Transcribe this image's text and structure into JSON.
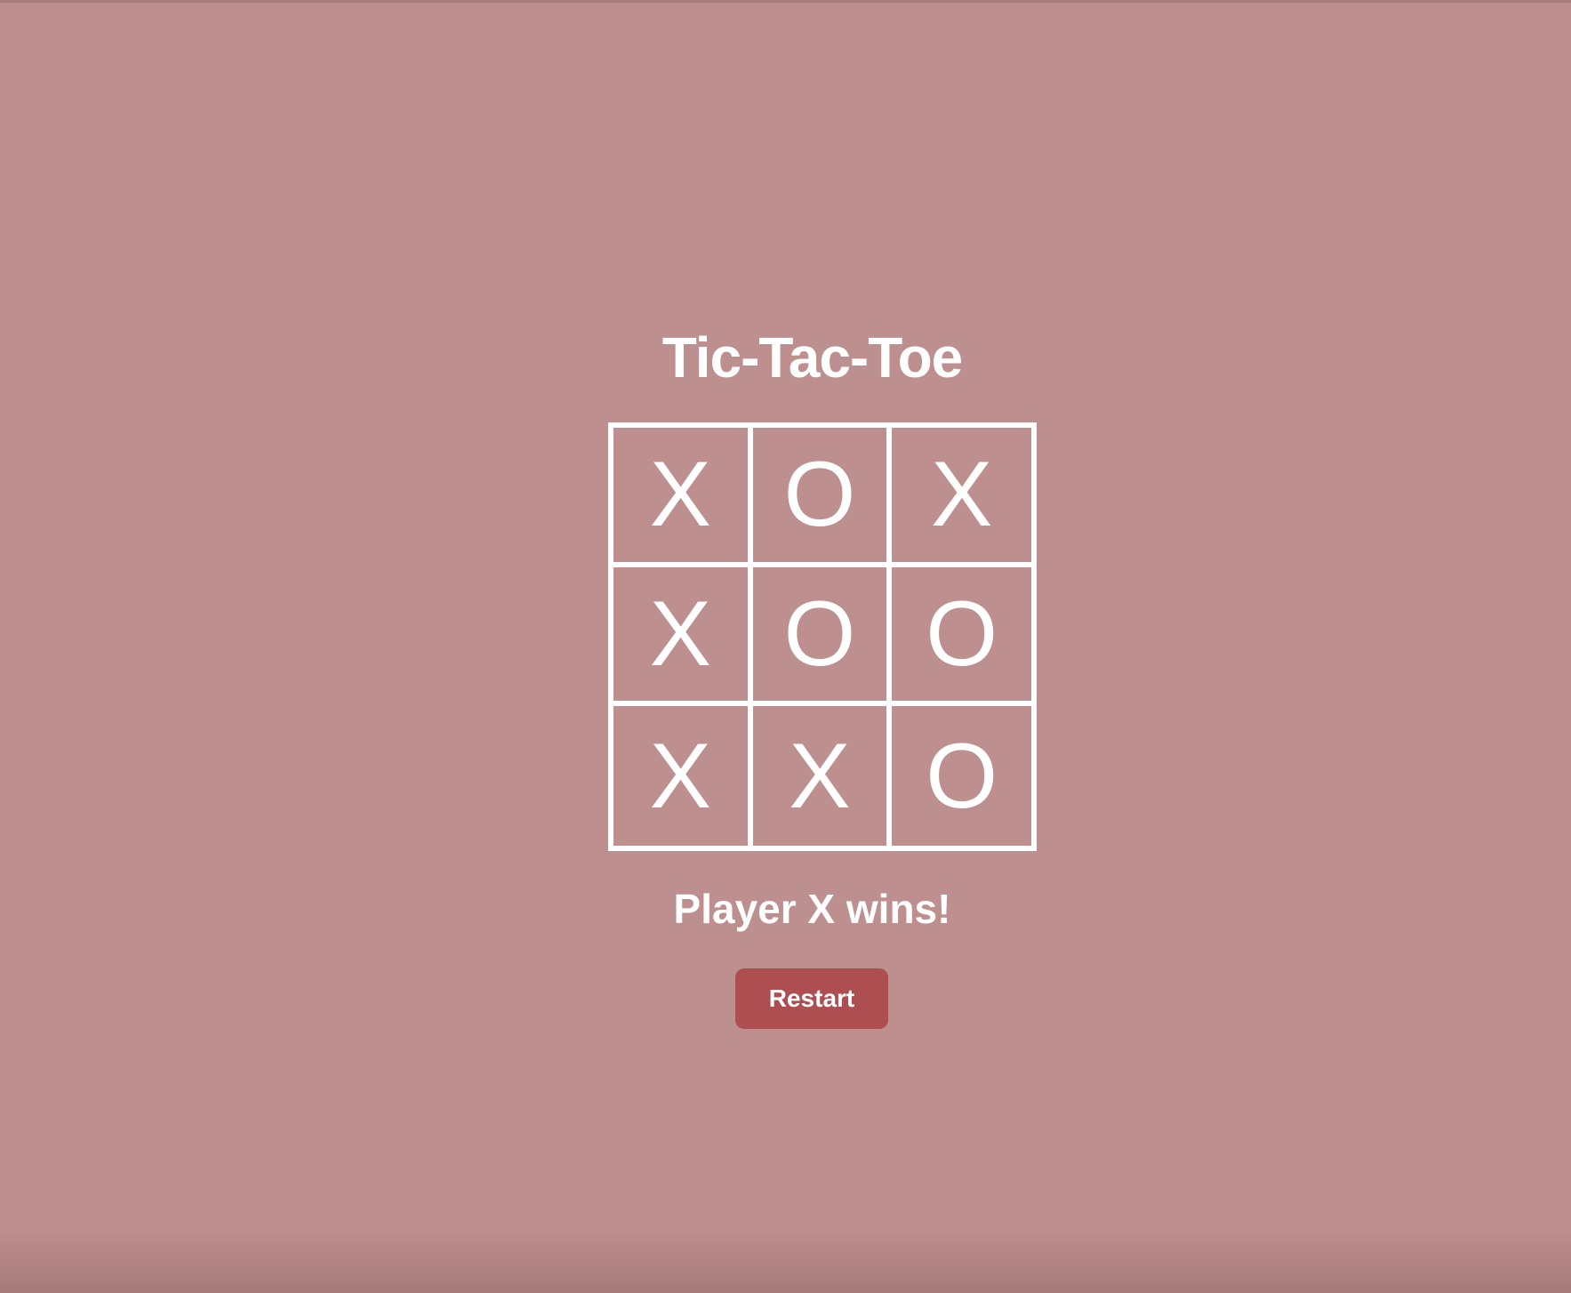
{
  "game": {
    "title": "Tic-Tac-Toe",
    "board": [
      [
        "X",
        "O",
        "X"
      ],
      [
        "X",
        "O",
        "O"
      ],
      [
        "X",
        "X",
        "O"
      ]
    ],
    "status": "Player X wins!",
    "restart_label": "Restart"
  },
  "colors": {
    "background": "#bd8f8e",
    "foreground": "#ffffff",
    "button": "#ad4f50"
  }
}
